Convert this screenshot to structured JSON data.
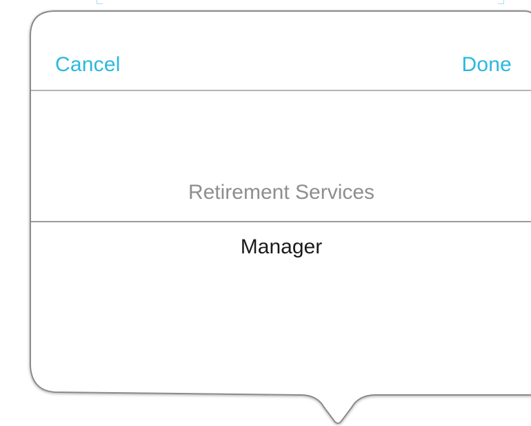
{
  "popover": {
    "cancel_label": "Cancel",
    "done_label": "Done",
    "accent_color": "#2ab8dd"
  },
  "picker": {
    "options": [
      "Retirement Services",
      "Manager"
    ],
    "selected_index": 1,
    "selected_value": "Manager"
  }
}
